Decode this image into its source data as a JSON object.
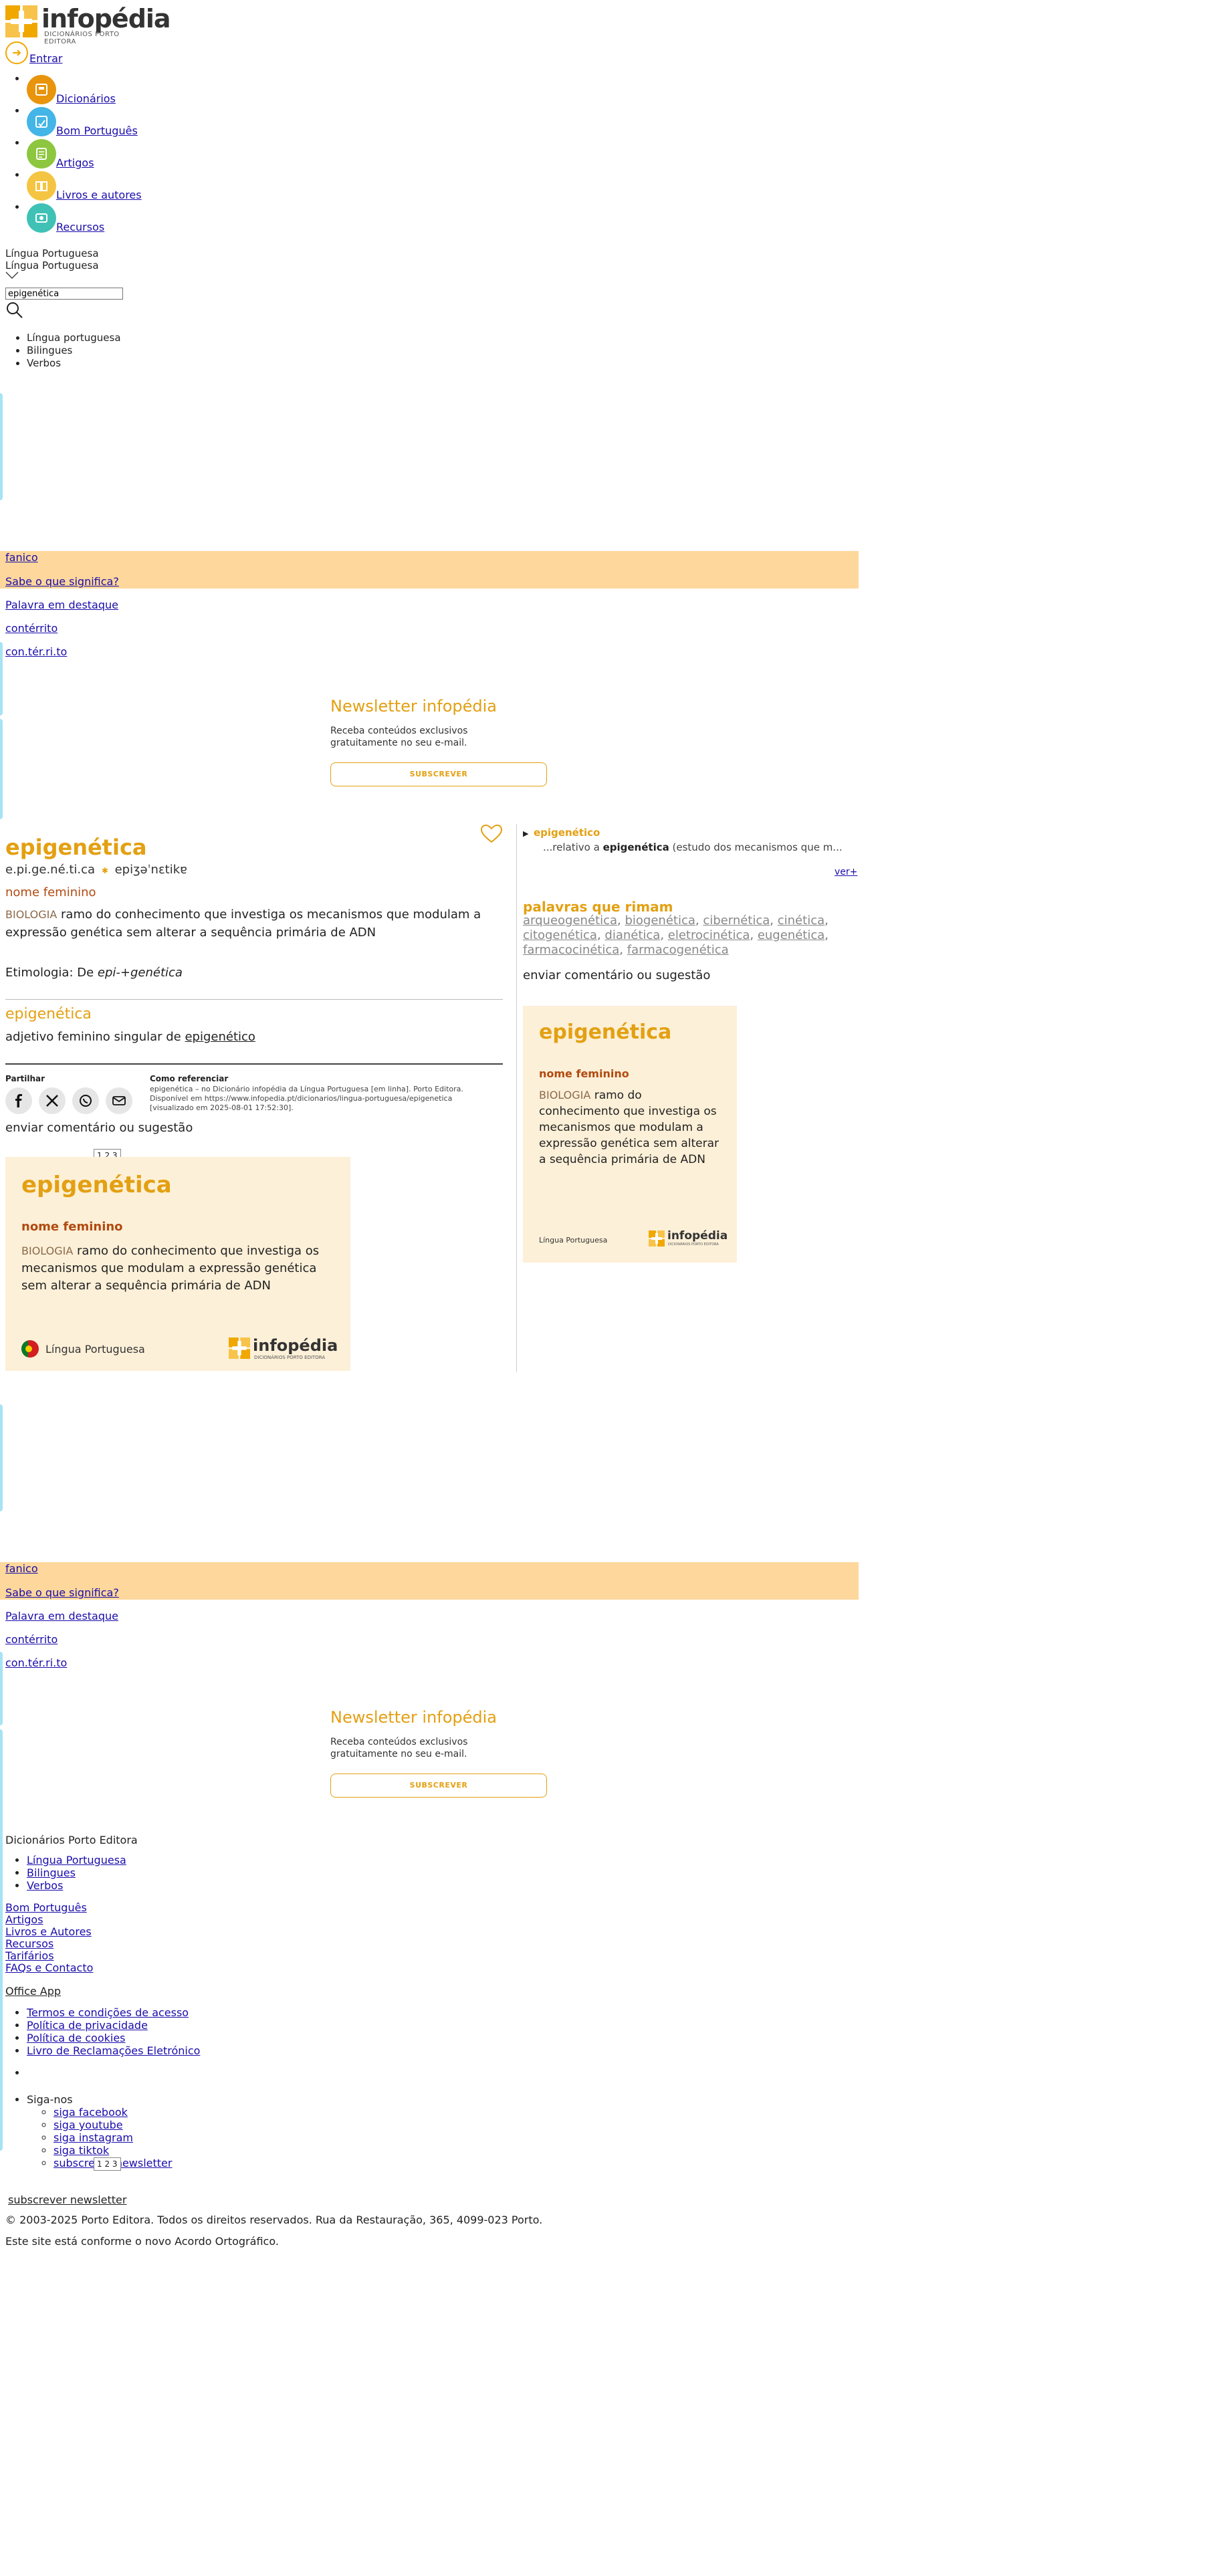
{
  "brand": {
    "name": "infopédia",
    "tagline": "DICIONÁRIOS PORTO EDITORA",
    "colors": {
      "accent": "#e3a012",
      "sense": "#b24a10",
      "promo": "#fdd79b",
      "card": "#fdf0d8",
      "side_bar": "#a6e3f5"
    }
  },
  "header": {
    "login_label": "Entrar",
    "nav": [
      {
        "label": "Dicionários",
        "icon": "dictionaries-icon",
        "color": "#e8940c"
      },
      {
        "label": "Bom Português",
        "icon": "bom-portugues-icon",
        "color": "#43b5e6"
      },
      {
        "label": "Artigos",
        "icon": "articles-icon",
        "color": "#8dc63f"
      },
      {
        "label": "Livros e autores",
        "icon": "books-icon",
        "color": "#f4c542"
      },
      {
        "label": "Recursos",
        "icon": "resources-icon",
        "color": "#3fc1b6"
      }
    ],
    "language_current": "Língua Portuguesa",
    "language_selected": "Língua Portuguesa",
    "search_value": "epigenética",
    "dictionaries": [
      "Língua portuguesa",
      "Bilingues",
      "Verbos"
    ]
  },
  "promo": {
    "word_label": "fanico",
    "question": "Sabe o que significa?",
    "featured_label": "Palavra em destaque",
    "featured_word": "contérrito",
    "featured_syll": "con.tér.ri.to",
    "newsletter_title": "Newsletter infopédia",
    "newsletter_desc": "Receba conteúdos exclusivos gratuitamente no seu e-mail.",
    "newsletter_button": "SUBSCREVER"
  },
  "entry": {
    "word": "epigenética",
    "syllables": "e.pi.ge.né.ti.ca",
    "phonetic": "epiʒəˈnɛtikɐ",
    "pos": "nome feminino",
    "domain": "BIOLOGIA",
    "definition": "ramo do conhecimento que investiga os mecanismos que modulam a expressão genética sem alterar a sequência primária de ADN",
    "etym_label": "Etimologia: De",
    "etym_value": "epi-+genética",
    "second_word": "epigenética",
    "second_def_prefix": "adjetivo feminino singular de",
    "second_def_link": "epigenético"
  },
  "share": {
    "title": "Partilhar",
    "cite_title": "Como referenciar",
    "cite_text": "epigenética – no Dicionário infopédia da Língua Portuguesa [em linha]. Porto Editora. Disponível em https://www.infopedia.pt/dicionarios/lingua-portuguesa/epigenetica [visualizado em 2025-08-01 17:52:30].",
    "feedback": "enviar comentário ou sugestão",
    "pager": "1 2 3"
  },
  "card": {
    "word": "epigenética",
    "pos": "nome feminino",
    "domain": "BIOLOGIA",
    "definition": "ramo do conhecimento que investiga os mecanismos que modulam a expressão genética sem alterar a sequência primária de ADN",
    "language": "Língua Portuguesa"
  },
  "sidebar": {
    "related_word": "epigenético",
    "related_desc_prefix": "...relativo a",
    "related_desc_bold": "epigenética",
    "related_desc_suffix": "(estudo dos mecanismos que m...",
    "more": "ver+",
    "rhyme_title": "palavras que rimam",
    "rhymes": [
      "arqueogenética",
      "biogenética",
      "cibernética",
      "cinética",
      "citogenética",
      "dianética",
      "eletrocinética",
      "eugenética",
      "farmacocinética",
      "farmacogenética"
    ],
    "feedback": "enviar comentário ou sugestão"
  },
  "footer": {
    "title": "Dicionários Porto Editora",
    "dict_links": [
      "Língua Portuguesa",
      "Bilingues",
      "Verbos"
    ],
    "links": [
      "Bom Português",
      "Artigos",
      "Livros e Autores",
      "Recursos",
      "Tarifários",
      "FAQs e Contacto"
    ],
    "office": "Office App",
    "legal": [
      "Termos e condições de acesso",
      "Política de privacidade",
      "Política de cookies",
      "Livro de Reclamações Eletrónico"
    ],
    "follow": "Siga-nos",
    "social": [
      "siga facebook",
      "siga youtube",
      "siga instagram",
      "siga tiktok",
      "subscrever newsletter"
    ],
    "subscribe": "subscrever newsletter",
    "copyright": "© 2003-2025 Porto Editora. Todos os direitos reservados. Rua da Restauração, 365, 4099-023 Porto.",
    "agreement": "Este site está conforme o novo Acordo Ortográfico."
  }
}
